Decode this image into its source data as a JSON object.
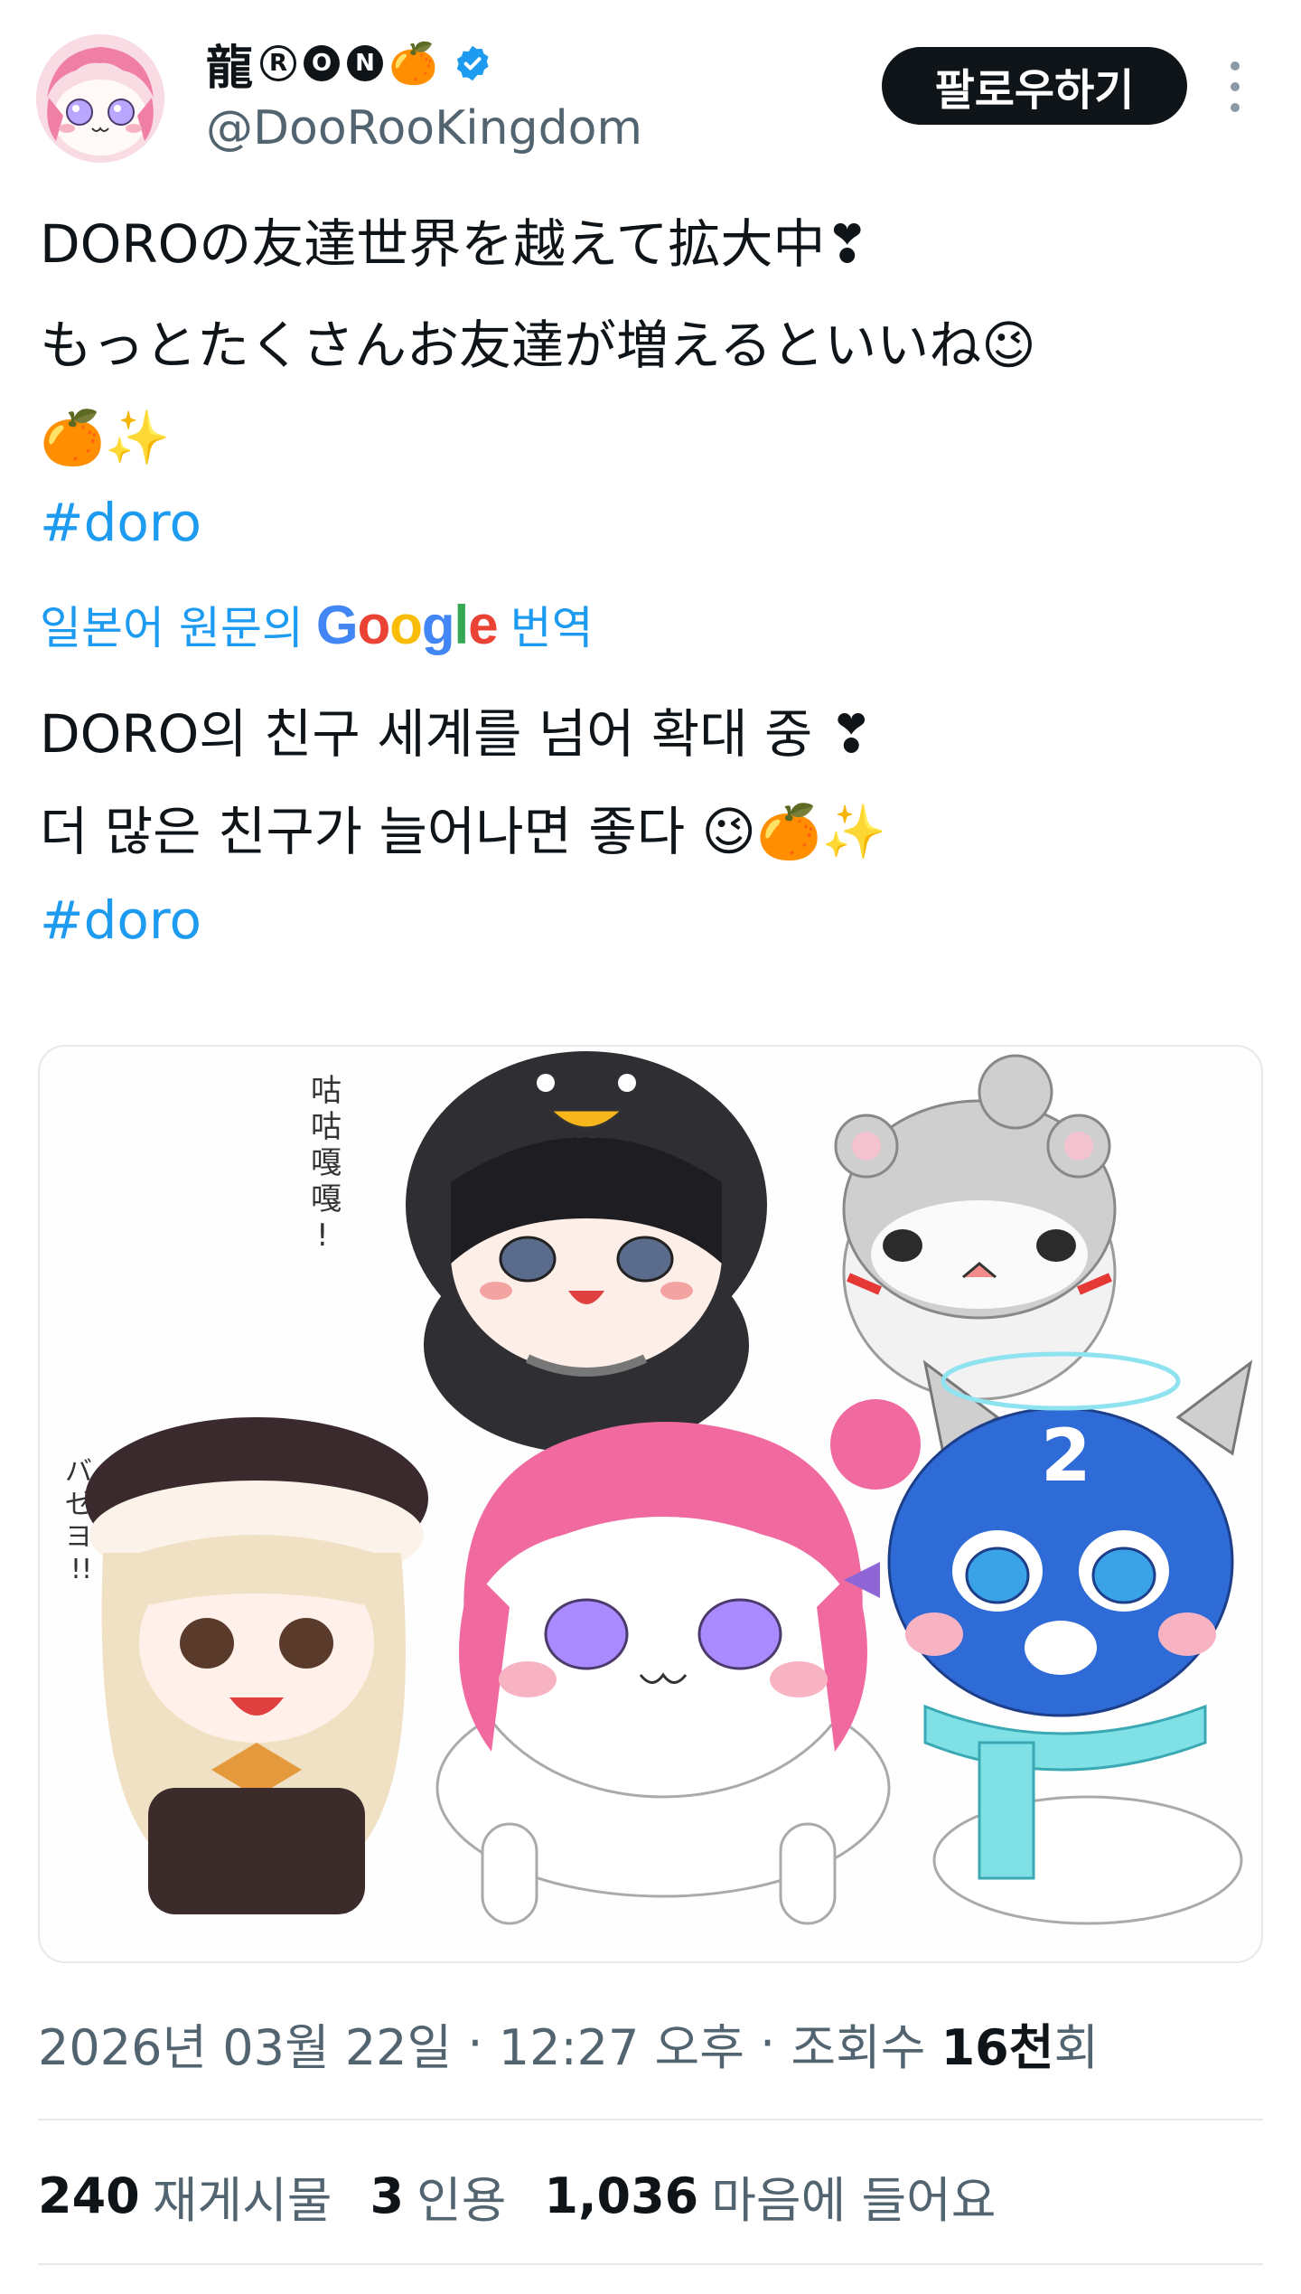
{
  "header": {
    "display_name": "龍",
    "name_letters": [
      "R",
      "O",
      "N"
    ],
    "name_emoji": "🍊",
    "verified_icon": "verified-badge-icon",
    "handle": "@DooRooKingdom",
    "follow_label": "팔로우하기",
    "more_icon": "more-vertical-icon"
  },
  "tweet": {
    "lines": [
      "DOROの友達世界を越えて拡大中❣",
      "もっとたくさんお友達が増えるといいね😉",
      "🍊✨"
    ],
    "hashtag": "#doro"
  },
  "translation": {
    "prefix": "일본어 원문의",
    "google": "Google",
    "suffix": "번역",
    "lines": [
      "DORO의 친구 세계를 넘어 확대 중 ❣",
      "더 많은 친구가 늘어나면 좋다 😉🍊✨"
    ],
    "hashtag": "#doro"
  },
  "media": {
    "text_vertical_1": "咕咕嘎嘎!",
    "text_vertical_2": "バゼヨ!!",
    "number_badge": "2"
  },
  "meta": {
    "date": "2026년 03월 22일",
    "sep1": " · ",
    "time": "12:27 오후",
    "sep2": " · ",
    "views_label": "조회수 ",
    "views_value": "16천",
    "views_suffix": "회"
  },
  "stats": {
    "reposts_value": "240",
    "reposts_label": "재게시물",
    "quotes_value": "3",
    "quotes_label": "인용",
    "likes_value": "1,036",
    "likes_label": "마음에 들어요"
  },
  "colors": {
    "accent": "#1d9bf0",
    "text": "#0f1419",
    "muted": "#536471",
    "border": "#e6e9ec"
  }
}
